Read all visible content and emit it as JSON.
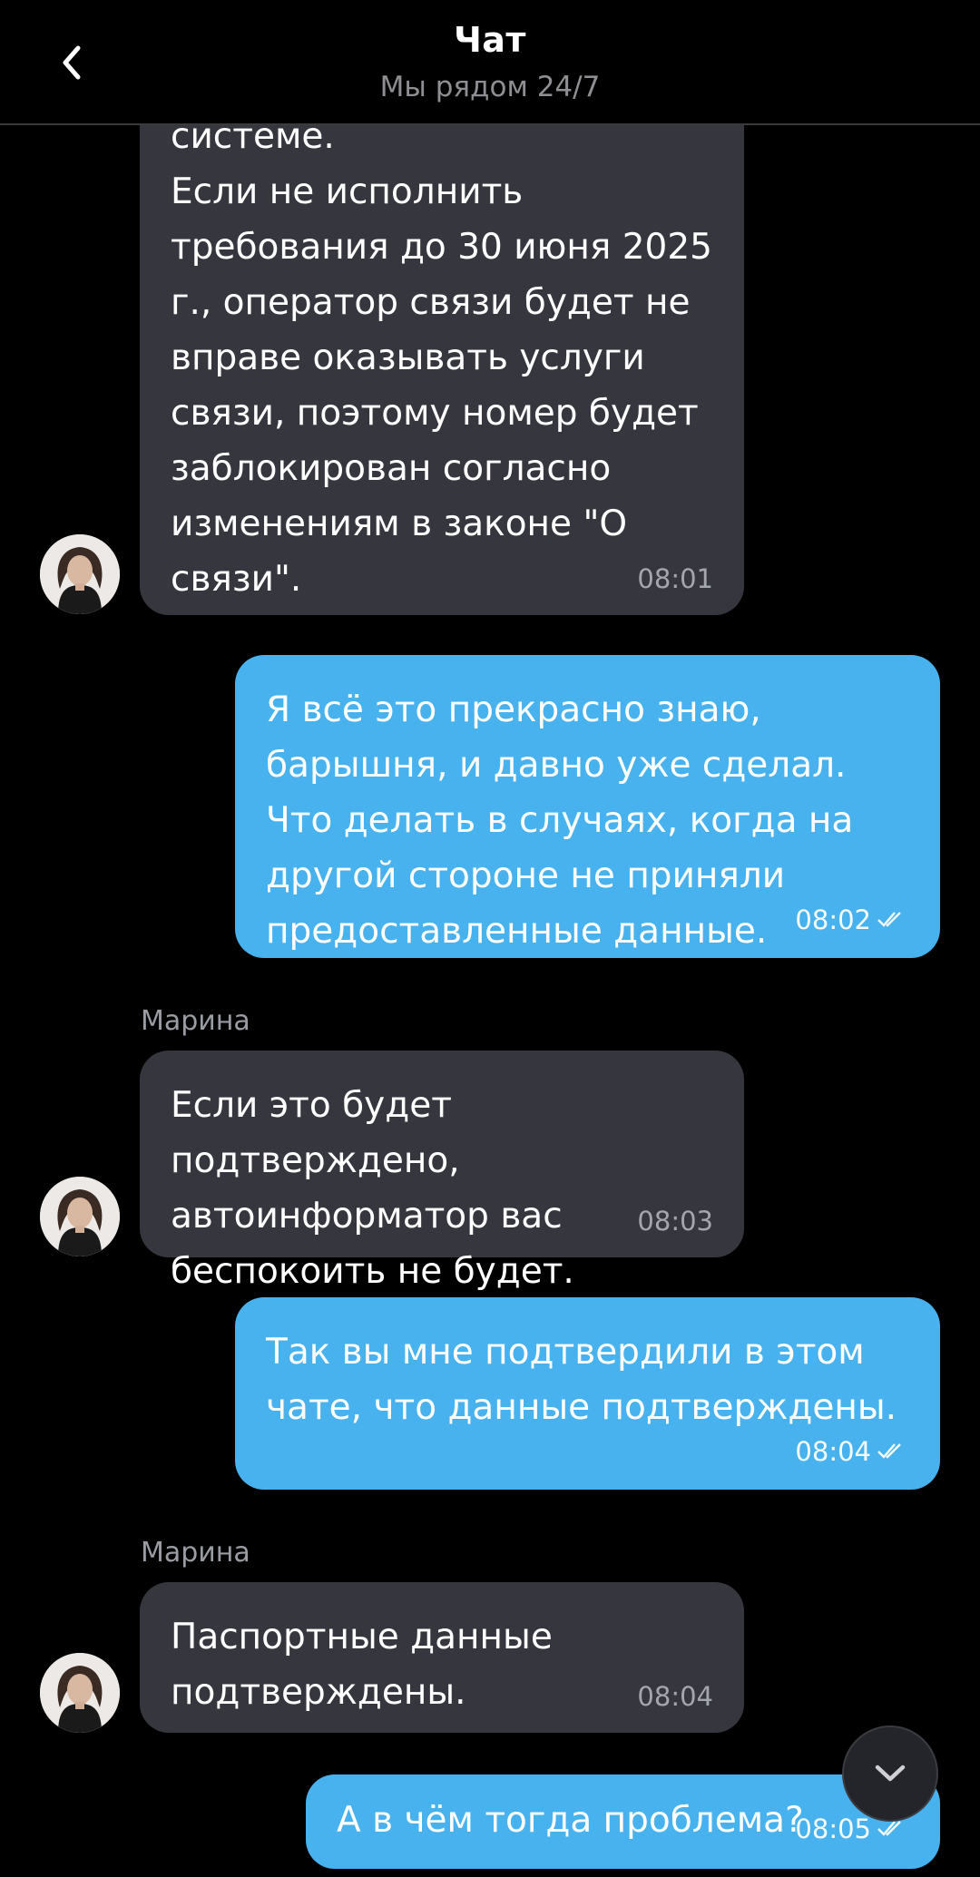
{
  "header": {
    "title": "Чат",
    "subtitle": "Мы рядом 24/7",
    "back_icon": "chevron-left-icon"
  },
  "messages": [
    {
      "direction": "incoming",
      "text": "системе.\nЕсли не исполнить требования до 30 июня 2025 г., оператор связи будет не вправе оказывать услуги связи, поэтому номер будет заблокирован согласно изменениям в законе \"О связи\".",
      "time": "08:01"
    },
    {
      "direction": "outgoing",
      "text": "Я всё это прекрасно знаю, барышня, и давно уже сделал. Что делать в случаях, когда на другой стороне не приняли предоставленные данные.",
      "time": "08:02",
      "status_icon": "double-check-icon"
    },
    {
      "direction": "incoming",
      "sender": "Марина",
      "text": "Если это будет подтверждено, автоинформатор вас беспокоить не будет.",
      "time": "08:03"
    },
    {
      "direction": "outgoing",
      "text": "Так вы мне подтвердили в этом чате, что данные подтверждены.",
      "time": "08:04",
      "status_icon": "double-check-icon"
    },
    {
      "direction": "incoming",
      "sender": "Марина",
      "text": "Паспортные данные подтверждены.",
      "time": "08:04"
    },
    {
      "direction": "outgoing",
      "text": "А в чём тогда проблема?",
      "time": "08:05",
      "status_icon": "double-check-icon"
    }
  ],
  "scroll_button": {
    "icon": "chevron-down-icon"
  },
  "colors": {
    "background": "#000000",
    "incoming_bubble": "#36373e",
    "outgoing_bubble": "#48b2ee",
    "meta_text": "#9a9ca3"
  }
}
